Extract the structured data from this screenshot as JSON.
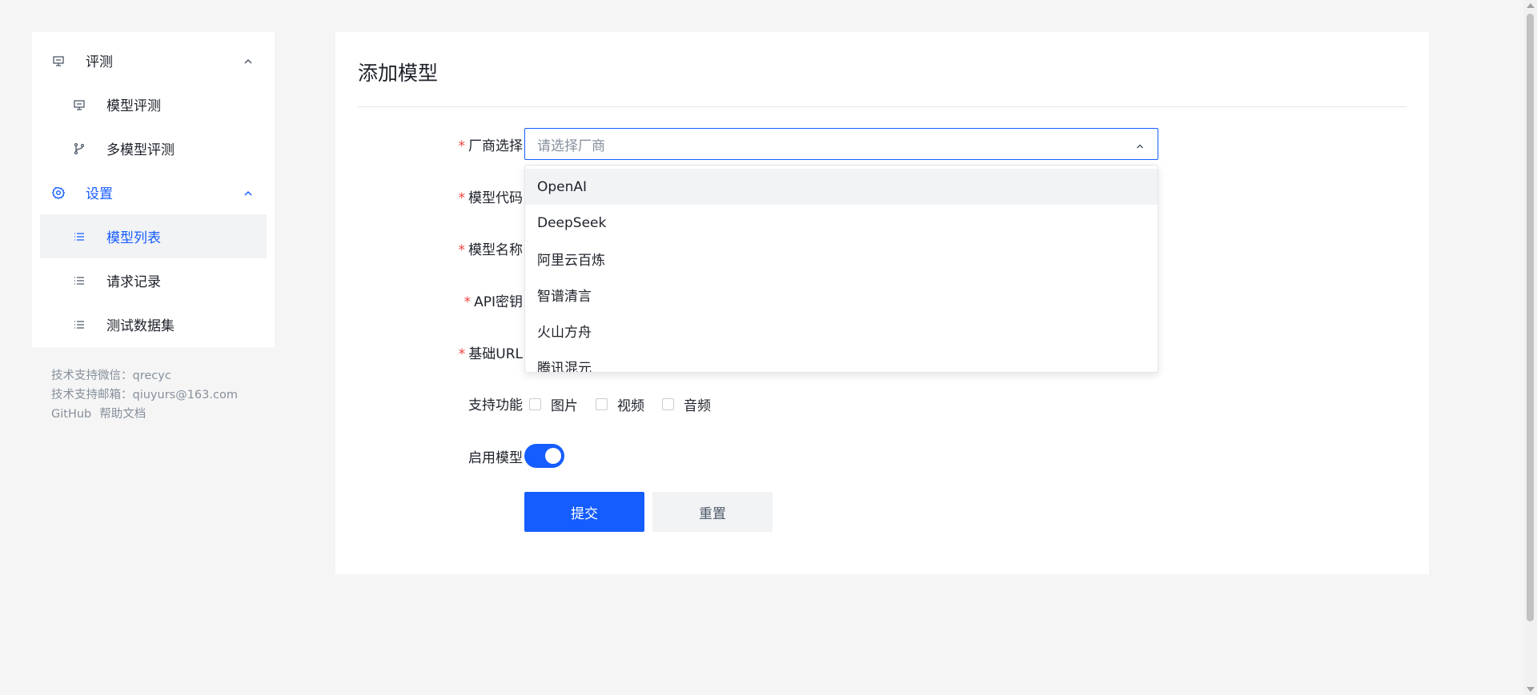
{
  "sidebar": {
    "groups": [
      {
        "label": "评测",
        "icon": "monitor-icon",
        "expanded": true
      },
      {
        "label": "设置",
        "icon": "gear-icon",
        "expanded": true,
        "active": true
      }
    ],
    "eval_items": [
      {
        "label": "模型评测",
        "icon": "monitor-icon"
      },
      {
        "label": "多模型评测",
        "icon": "branch-icon"
      }
    ],
    "settings_items": [
      {
        "label": "模型列表",
        "icon": "list-icon",
        "active": true
      },
      {
        "label": "请求记录",
        "icon": "list-icon"
      },
      {
        "label": "测试数据集",
        "icon": "list-icon"
      }
    ]
  },
  "support": {
    "wechat": "技术支持微信：qrecyc",
    "email": "技术支持邮箱：qiuyurs@163.com",
    "github": "GitHub",
    "docs": "帮助文档"
  },
  "form": {
    "title": "添加模型",
    "vendor_label": "厂商选择",
    "vendor_placeholder": "请选择厂商",
    "model_code_label": "模型代码",
    "model_name_label": "模型名称",
    "api_key_label": "API密钥",
    "base_url_label": "基础URL",
    "features_label": "支持功能",
    "features": [
      "图片",
      "视频",
      "音频"
    ],
    "enable_label": "启用模型",
    "enabled": true,
    "submit": "提交",
    "reset": "重置",
    "required_mark": "*"
  },
  "dropdown": {
    "options": [
      "OpenAI",
      "DeepSeek",
      "阿里云百炼",
      "智谱清言",
      "火山方舟",
      "腾讯混元"
    ],
    "hovered_index": 0
  },
  "colors": {
    "primary": "#165dff",
    "required": "#f53f3f",
    "background": "#f5f5f5"
  }
}
